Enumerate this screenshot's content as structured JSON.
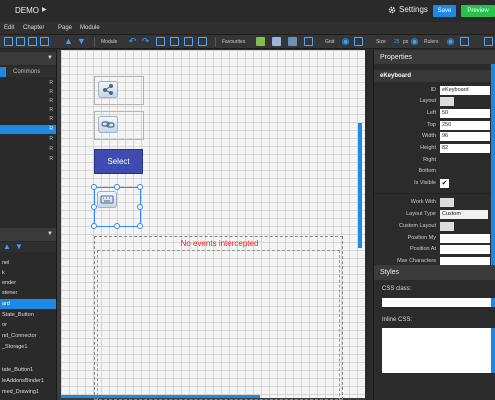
{
  "app": {
    "title": "DEMO",
    "play_glyph": "▶",
    "settings_label": "Settings",
    "save_label": "Save",
    "preview_label": "Preview"
  },
  "menu": [
    "Edit",
    "Chapter",
    "Page",
    "Module"
  ],
  "toolbar": {
    "module_label": "Module",
    "favourites_label": "Favourites",
    "grid_label": "Grid",
    "size_label": "Size",
    "size_value": "25",
    "size_unit": "px",
    "rulers_label": "Rulers"
  },
  "left_panel": {
    "commons_tab": "Commons",
    "page_marker": "R",
    "components": [
      "nel",
      "k",
      "ender",
      "stener",
      "ard",
      "State_Button",
      "or",
      "nd_Connector",
      "_Storage1",
      "",
      "tate_Button1",
      "leAddonsBinder1",
      "med_Drawing1"
    ],
    "selected_component_index": 4
  },
  "canvas": {
    "select_button_label": "Select",
    "events_label": "No events intercepted"
  },
  "properties": {
    "title": "Properties",
    "component_name": "eKeyboard",
    "rows": [
      {
        "label": "ID",
        "value": "eKeyboard",
        "kind": "text"
      },
      {
        "label": "Layout",
        "value": "",
        "kind": "small"
      },
      {
        "label": "Left",
        "value": "50",
        "kind": "text"
      },
      {
        "label": "Top",
        "value": "250",
        "kind": "text"
      },
      {
        "label": "Width",
        "value": "96",
        "kind": "text"
      },
      {
        "label": "Height",
        "value": "82",
        "kind": "text"
      },
      {
        "label": "Right",
        "value": "",
        "kind": "none"
      },
      {
        "label": "Bottom",
        "value": "",
        "kind": "none"
      },
      {
        "label": "Is Visible",
        "value": "✔",
        "kind": "check"
      },
      {
        "label": "Work With",
        "value": "",
        "kind": "small"
      },
      {
        "label": "Layout Type",
        "value": "Custom",
        "kind": "dropdown"
      },
      {
        "label": "Custom Layout",
        "value": "",
        "kind": "small"
      },
      {
        "label": "Position My",
        "value": "",
        "kind": "text"
      },
      {
        "label": "Position At",
        "value": "",
        "kind": "text"
      },
      {
        "label": "Max Characters",
        "value": "",
        "kind": "text"
      }
    ]
  },
  "styles": {
    "title": "Styles",
    "css_class_label": "CSS class:",
    "css_class_value": "",
    "inline_css_label": "Inline CSS:",
    "inline_css_value": ""
  },
  "colors": {
    "accent": "#1e88e5",
    "preview": "#27c24c",
    "select_button": "#3d4cae",
    "events_text": "#ff1a1a"
  },
  "icons": [
    "play-icon",
    "gear-icon",
    "undo-icon",
    "redo-icon",
    "arrow-up-icon",
    "arrow-down-icon",
    "eye-icon",
    "chevron-down-icon"
  ]
}
